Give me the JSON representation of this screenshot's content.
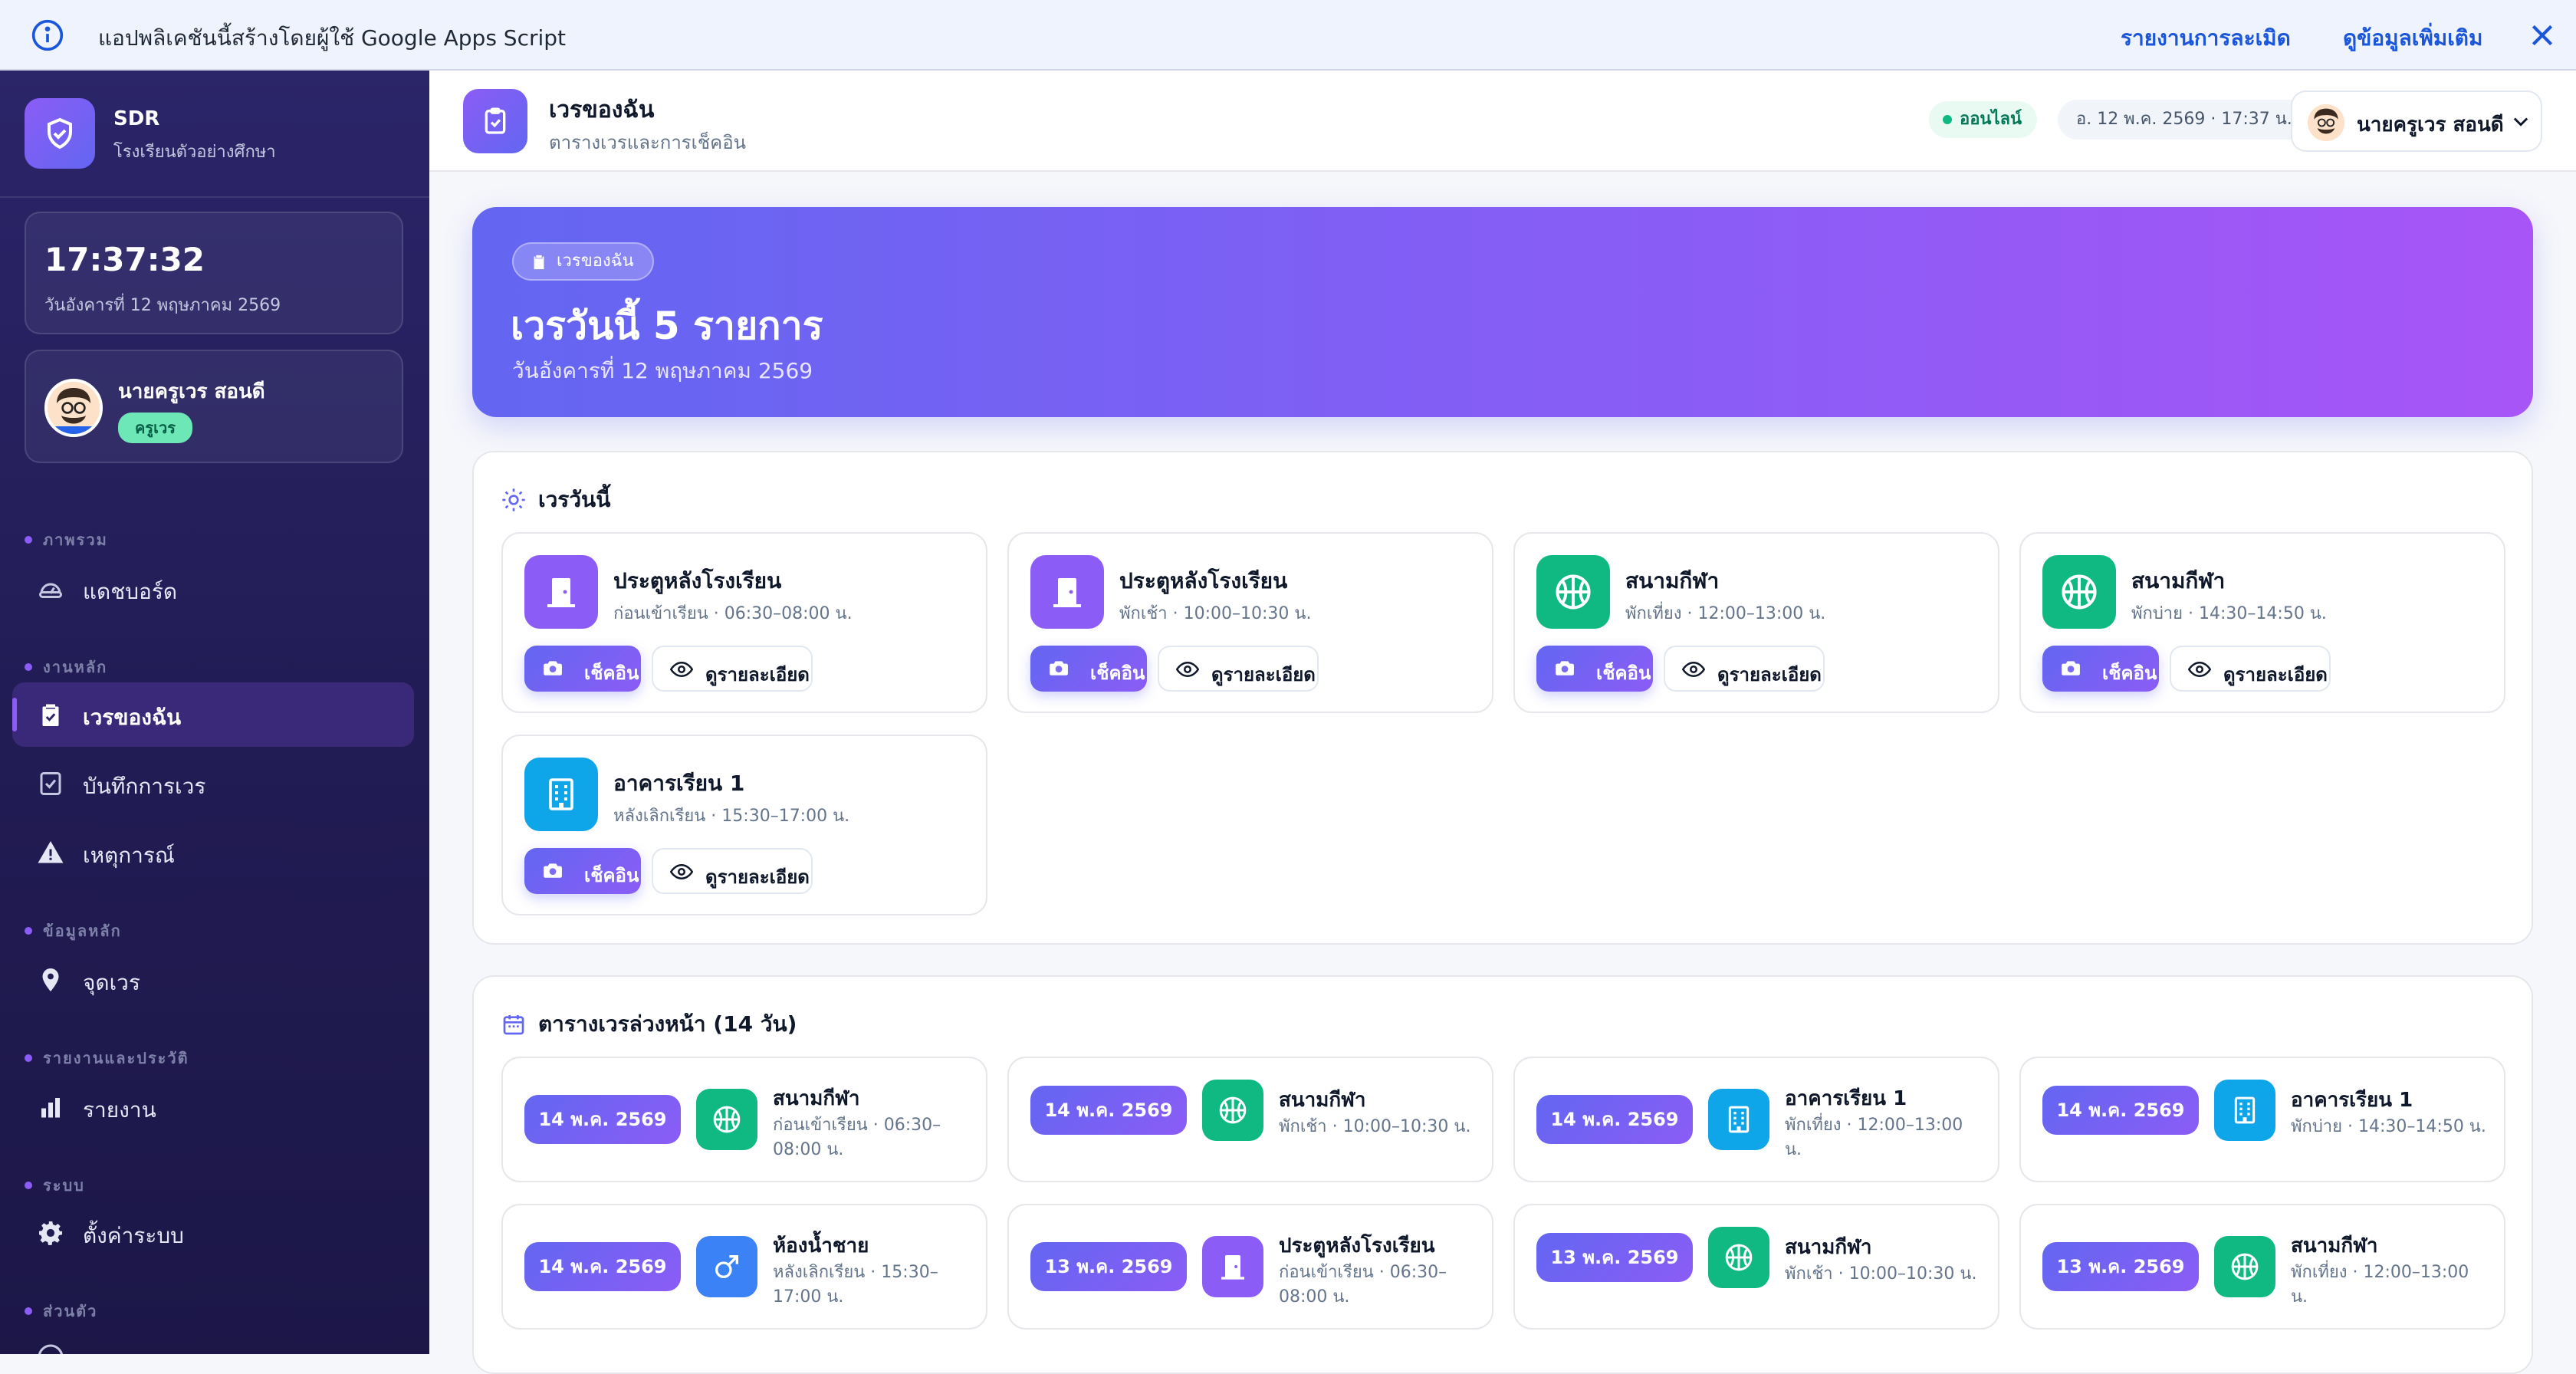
{
  "banner": {
    "text": "แอปพลิเคชันนี้สร้างโดยผู้ใช้ Google Apps Script",
    "report_link": "รายงานการละเมิด",
    "more_link": "ดูข้อมูลเพิ่มเติม"
  },
  "sidebar": {
    "brand_name": "SDR",
    "brand_sub": "โรงเรียนตัวอย่างศึกษา",
    "clock": "17:37:32",
    "clock_date": "วันอังคารที่ 12 พฤษภาคม 2569",
    "user_name": "นายครูเวร สอนดี",
    "user_role": "ครูเวร",
    "sections": {
      "overview": "ภาพรวม",
      "main_work": "งานหลัก",
      "master_data": "ข้อมูลหลัก",
      "reports_history": "รายงานและประวัติ",
      "system": "ระบบ",
      "personal": "ส่วนตัว"
    },
    "items": {
      "dashboard": "แดชบอร์ด",
      "my_duty": "เวรของฉัน",
      "duty_log": "บันทึกการเวร",
      "incidents": "เหตุการณ์",
      "duty_points": "จุดเวร",
      "reports": "รายงาน",
      "settings": "ตั้งค่าระบบ"
    }
  },
  "topbar": {
    "title": "เวรของฉัน",
    "subtitle": "ตารางเวรและการเช็คอิน",
    "status": "ออนไลน์",
    "datetime": "อ. 12 พ.ค. 2569 · 17:37 น.",
    "user_name": "นายครูเวร สอนดี"
  },
  "hero": {
    "badge": "เวรของฉัน",
    "title": "เวรวันนี้ 5 รายการ",
    "subtitle": "วันอังคารที่ 12 พฤษภาคม 2569"
  },
  "today": {
    "title": "เวรวันนี้",
    "checkin_label": "เช็คอิน",
    "detail_label": "ดูรายละเอียด",
    "duties": [
      {
        "name": "ประตูหลังโรงเรียน",
        "time": "ก่อนเข้าเรียน · 06:30–08:00 น.",
        "icon": "door-icon",
        "color": "#8b5cf6"
      },
      {
        "name": "ประตูหลังโรงเรียน",
        "time": "พักเช้า · 10:00–10:30 น.",
        "icon": "door-icon",
        "color": "#8b5cf6"
      },
      {
        "name": "สนามกีฬา",
        "time": "พักเที่ยง · 12:00–13:00 น.",
        "icon": "basketball-icon",
        "color": "#10b981"
      },
      {
        "name": "สนามกีฬา",
        "time": "พักบ่าย · 14:30–14:50 น.",
        "icon": "basketball-icon",
        "color": "#10b981"
      },
      {
        "name": "อาคารเรียน 1",
        "time": "หลังเลิกเรียน · 15:30–17:00 น.",
        "icon": "building-icon",
        "color": "#0ea5e9"
      }
    ]
  },
  "schedule": {
    "title": "ตารางเวรล่วงหน้า (14 วัน)",
    "items": [
      {
        "date": "14 พ.ค. 2569",
        "name": "สนามกีฬา",
        "time": "ก่อนเข้าเรียน · 06:30–08:00 น.",
        "icon": "basketball-icon",
        "color": "#10b981"
      },
      {
        "date": "14 พ.ค. 2569",
        "name": "สนามกีฬา",
        "time": "พักเช้า · 10:00–10:30 น.",
        "icon": "basketball-icon",
        "color": "#10b981"
      },
      {
        "date": "14 พ.ค. 2569",
        "name": "อาคารเรียน 1",
        "time": "พักเที่ยง · 12:00–13:00 น.",
        "icon": "building-icon",
        "color": "#0ea5e9"
      },
      {
        "date": "14 พ.ค. 2569",
        "name": "อาคารเรียน 1",
        "time": "พักบ่าย · 14:30–14:50 น.",
        "icon": "building-icon",
        "color": "#0ea5e9"
      },
      {
        "date": "14 พ.ค. 2569",
        "name": "ห้องน้ำชาย",
        "time": "หลังเลิกเรียน · 15:30–17:00 น.",
        "icon": "male-icon",
        "color": "#3b82f6"
      },
      {
        "date": "13 พ.ค. 2569",
        "name": "ประตูหลังโรงเรียน",
        "time": "ก่อนเข้าเรียน · 06:30–08:00 น.",
        "icon": "door-icon",
        "color": "#8b5cf6"
      },
      {
        "date": "13 พ.ค. 2569",
        "name": "สนามกีฬา",
        "time": "พักเช้า · 10:00–10:30 น.",
        "icon": "basketball-icon",
        "color": "#10b981"
      },
      {
        "date": "13 พ.ค. 2569",
        "name": "สนามกีฬา",
        "time": "พักเที่ยง · 12:00–13:00 น.",
        "icon": "basketball-icon",
        "color": "#10b981"
      }
    ]
  }
}
